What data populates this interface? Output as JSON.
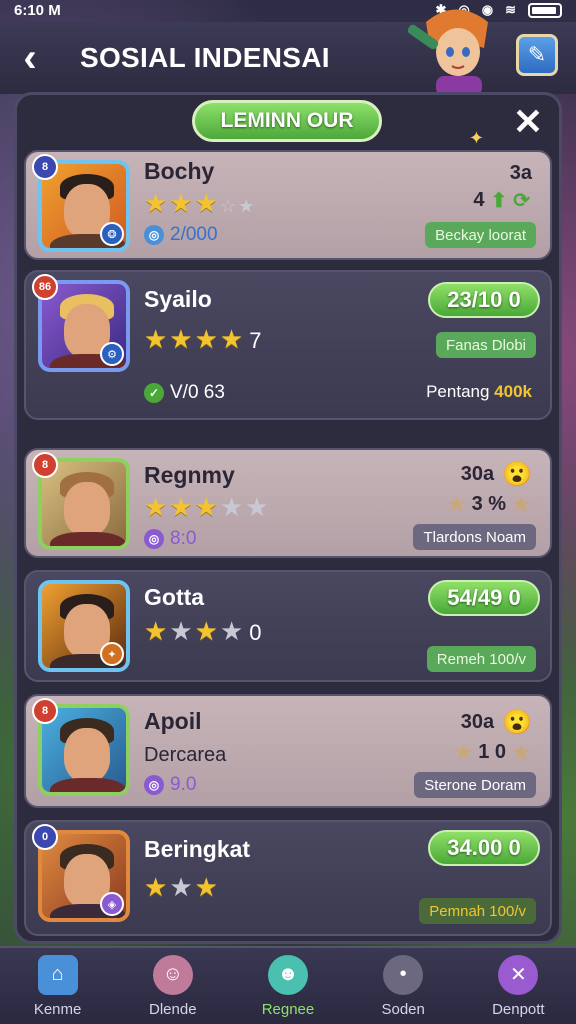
{
  "status": {
    "time": "6:10 M"
  },
  "header": {
    "title": "SOSIAL INDENSAI"
  },
  "panel": {
    "tab_label": "LEMINN OUR",
    "close_symbol": "✕"
  },
  "cards": [
    {
      "theme": "light",
      "rank": "8",
      "name": "Bochy",
      "stars_on": 3,
      "stars_total": 5,
      "extra": "",
      "coin_color": "#4a90d8",
      "coin_value": "2/000",
      "right_top": "3a",
      "right_mid": "4",
      "tag": "Beckay loorat",
      "tag_style": "green"
    },
    {
      "theme": "dark",
      "rank": "86",
      "name": "Syailo",
      "stars_on": 4,
      "stars_total": 4,
      "extra": "7",
      "coin_color": "#4aa838",
      "coin_value": "V/0 63",
      "score": "23/10 0",
      "tag": "Fanas Dlobi",
      "tag_style": "green",
      "bottom_right_label": "Pentang",
      "bottom_right_value": "400k"
    },
    {
      "theme": "light",
      "rank": "8",
      "name": "Regnmy",
      "stars_on": 3,
      "stars_total": 5,
      "extra": "",
      "coin_color": "#8a5ad0",
      "coin_value": "8:0",
      "right_top": "30a",
      "right_mid": "3 %",
      "tag": "Tlardons Noam",
      "tag_style": "grey"
    },
    {
      "theme": "dark",
      "rank": "",
      "name": "Gotta",
      "stars_on": 2,
      "stars_total": 4,
      "extra": "0",
      "score": "54/49 0",
      "tag": "Remeh 100/v",
      "tag_style": "green"
    },
    {
      "theme": "light",
      "rank": "8",
      "name": "Apoil",
      "subtitle": "Dercarea",
      "coin_color": "#8a5ad0",
      "coin_value": "9.0",
      "right_top": "30a",
      "right_mid": "1 0",
      "tag": "Sterone Doram",
      "tag_style": "grey"
    },
    {
      "theme": "dark",
      "rank": "0",
      "name": "Beringkat",
      "stars_on": 2,
      "stars_total": 3,
      "extra": "",
      "score": "34.00 0",
      "tag": "Pemnah 100/v",
      "tag_style": "green"
    }
  ],
  "nav": [
    {
      "label": "Kenme",
      "icon": "home-icon",
      "color": "#4a90d8"
    },
    {
      "label": "Dlende",
      "icon": "avatar-icon",
      "color": "#c07a9a"
    },
    {
      "label": "Regnee",
      "icon": "smile-icon",
      "color": "#4ac0b0"
    },
    {
      "label": "Soden",
      "icon": "dot-icon",
      "color": "#6b6880"
    },
    {
      "label": "Denpott",
      "icon": "close-circle-icon",
      "color": "#9a5ad0"
    }
  ]
}
